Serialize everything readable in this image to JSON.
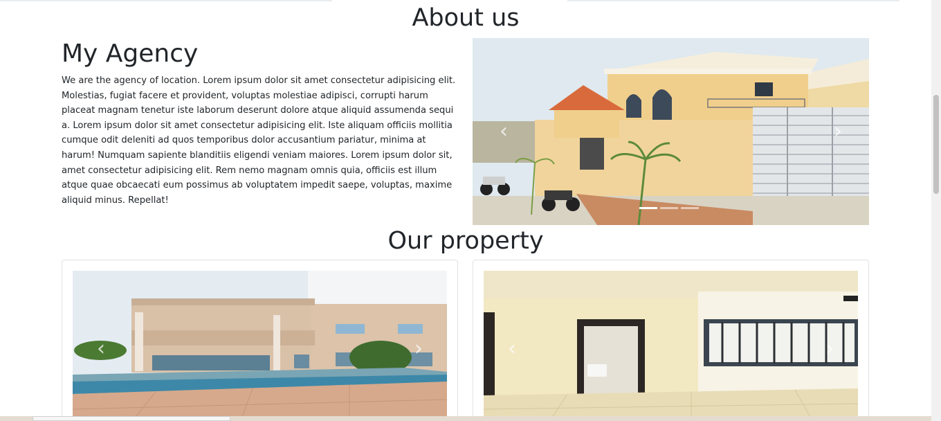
{
  "about": {
    "section_title": "About us",
    "agency_title": "My Agency",
    "agency_text": "We are the agency of location. Lorem ipsum dolor sit amet consectetur adipisicing elit. Molestias, fugiat facere et provident, voluptas molestiae adipisci, corrupti harum placeat magnam tenetur iste laborum deserunt dolore atque aliquid assumenda sequi a. Lorem ipsum dolor sit amet consectetur adipisicing elit. Iste aliquam officiis mollitia cumque odit deleniti ad quos temporibus dolor accusantium pariatur, minima at harum! Numquam sapiente blanditiis eligendi veniam maiores. Lorem ipsum dolor sit, amet consectetur adipisicing elit. Rem nemo magnam omnis quia, officiis est illum atque quae obcaecati eum possimus ab voluptatem impedit saepe, voluptas, maxime aliquid minus. Repellat!",
    "carousel": {
      "prev_glyph": "‹",
      "next_glyph": "›",
      "indicator_count": 3,
      "active_index": 0
    }
  },
  "property": {
    "section_title": "Our property",
    "cards": [
      {
        "prev_glyph": "‹",
        "next_glyph": "›"
      },
      {
        "prev_glyph": "‹",
        "next_glyph": "›"
      }
    ]
  },
  "colors": {
    "text": "#212529",
    "card_border": "#dfe2e6",
    "house_wall": "#f0cf8c",
    "roof_tile": "#d96a3c",
    "sky": "#dfe9ef"
  }
}
